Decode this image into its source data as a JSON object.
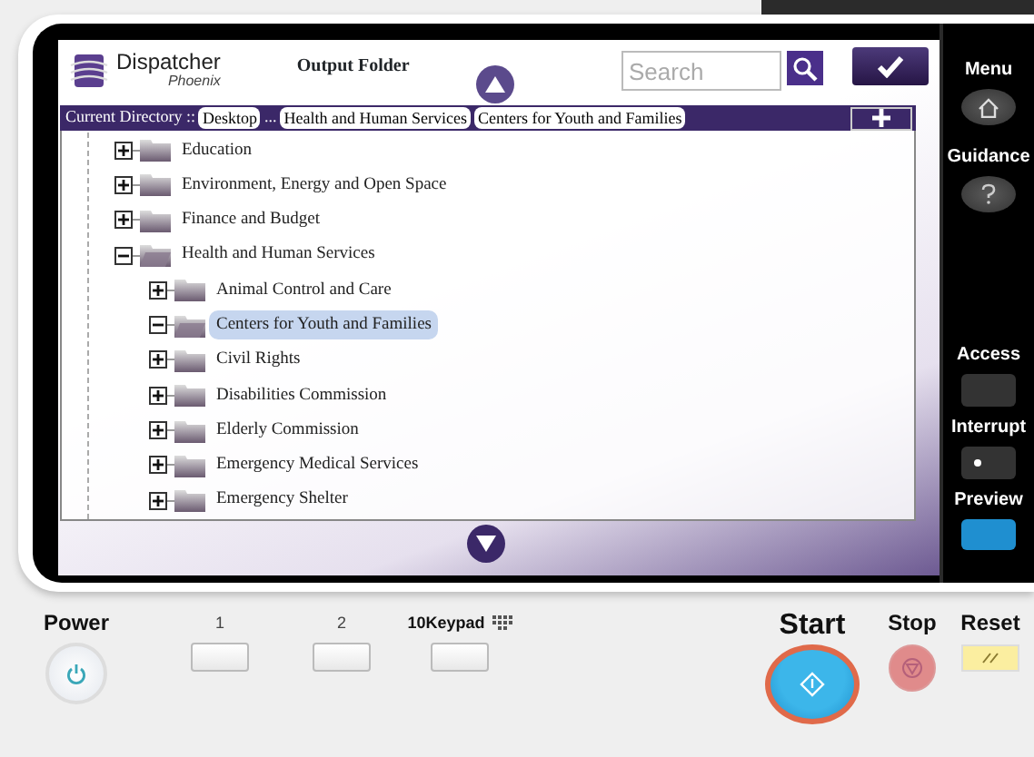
{
  "header": {
    "logo": {
      "name": "Dispatcher",
      "subtitle": "Phoenix"
    },
    "title": "Output Folder",
    "search": {
      "placeholder": "Search"
    }
  },
  "breadcrumb": {
    "label": "Current Directory ::",
    "items": [
      {
        "kind": "crumb",
        "text": "Desktop"
      },
      {
        "kind": "gap",
        "text": "..."
      },
      {
        "kind": "crumb",
        "text": "Health and Human Services"
      },
      {
        "kind": "crumb",
        "text": "Centers for Youth and Families"
      }
    ]
  },
  "tree": [
    {
      "label": "Education",
      "expanded": false,
      "selected": false
    },
    {
      "label": "Environment, Energy and Open Space",
      "expanded": false,
      "selected": false
    },
    {
      "label": "Finance and Budget",
      "expanded": false,
      "selected": false
    },
    {
      "label": "Health and Human Services",
      "expanded": true,
      "selected": false,
      "children": [
        {
          "label": "Animal Control and Care",
          "expanded": false,
          "selected": false
        },
        {
          "label": "Centers for Youth and Families",
          "expanded": true,
          "selected": true
        },
        {
          "label": "Civil Rights",
          "expanded": false,
          "selected": false
        },
        {
          "label": "Disabilities Commission",
          "expanded": false,
          "selected": false
        },
        {
          "label": "Elderly Commission",
          "expanded": false,
          "selected": false
        },
        {
          "label": "Emergency Medical Services",
          "expanded": false,
          "selected": false
        },
        {
          "label": "Emergency Shelter",
          "expanded": false,
          "selected": false
        }
      ]
    }
  ],
  "side_keys": [
    {
      "label": "Menu",
      "kind": "home"
    },
    {
      "label": "Guidance",
      "kind": "help"
    },
    {
      "label": "Access",
      "kind": "blank"
    },
    {
      "label": "Interrupt",
      "kind": "dot"
    },
    {
      "label": "Preview",
      "kind": "lit"
    }
  ],
  "panel": {
    "power": "Power",
    "keys": [
      {
        "label": "1",
        "kind": "plain"
      },
      {
        "label": "2",
        "kind": "plain"
      },
      {
        "label": "10Keypad",
        "kind": "keypad"
      }
    ],
    "start": "Start",
    "stop": "Stop",
    "reset": "Reset"
  }
}
